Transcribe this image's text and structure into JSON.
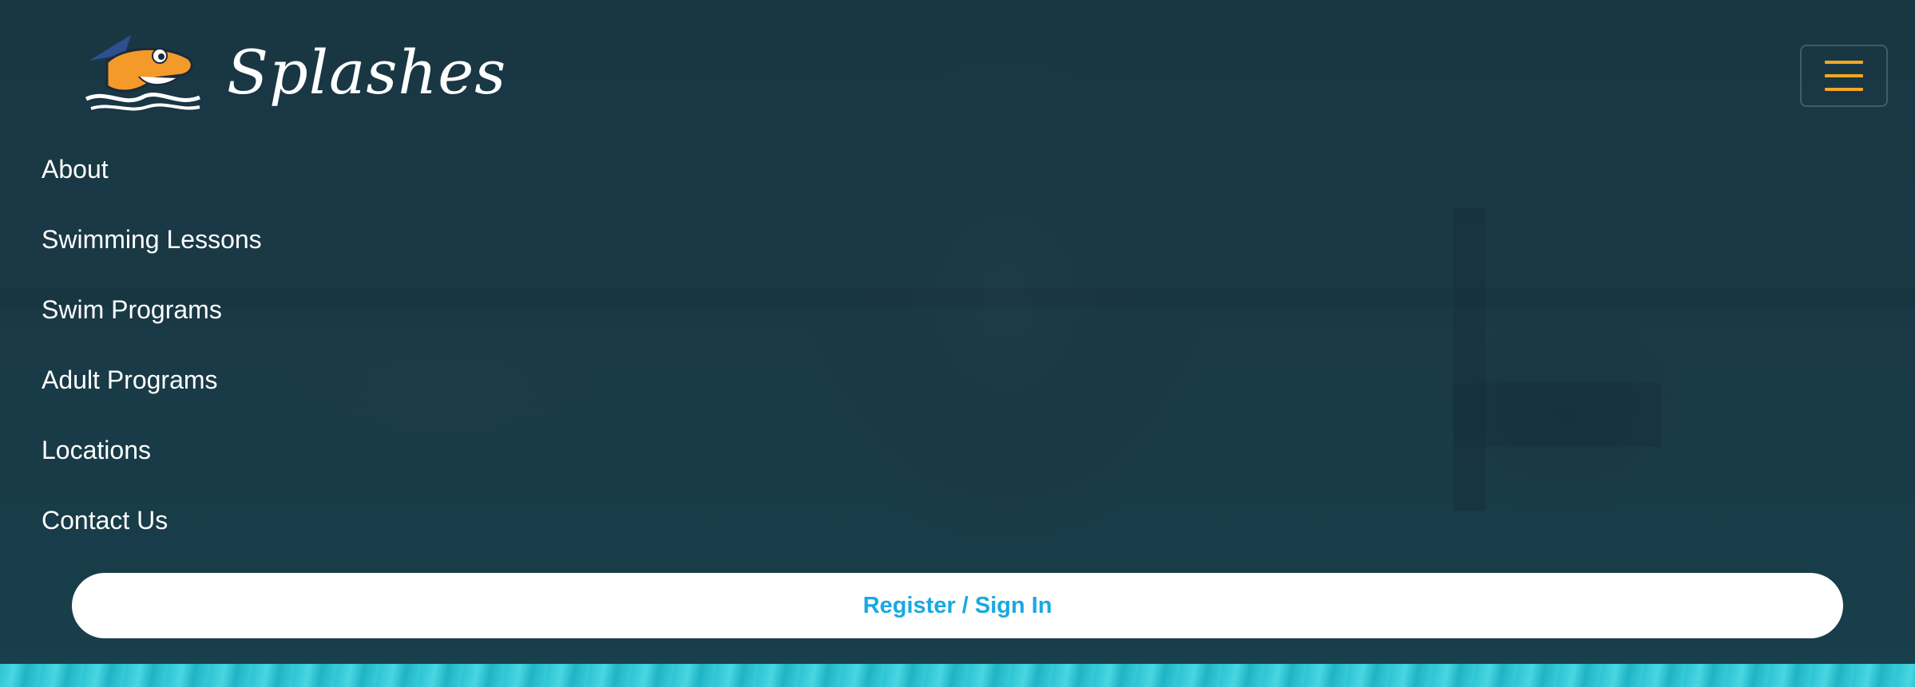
{
  "brand": {
    "name": "Splashes",
    "logo_icon": "shark-mascot-icon"
  },
  "header": {
    "menu_toggle_icon": "hamburger-menu-icon",
    "menu_toggle_color": "#f5a623"
  },
  "nav": {
    "items": [
      {
        "label": "About"
      },
      {
        "label": "Swimming Lessons"
      },
      {
        "label": "Swim Programs"
      },
      {
        "label": "Adult Programs"
      },
      {
        "label": "Locations"
      },
      {
        "label": "Contact Us"
      }
    ]
  },
  "cta": {
    "register_label": "Register / Sign In",
    "color": "#1aa8e0"
  },
  "theme": {
    "overlay": "#16303c",
    "text": "#ffffff"
  }
}
